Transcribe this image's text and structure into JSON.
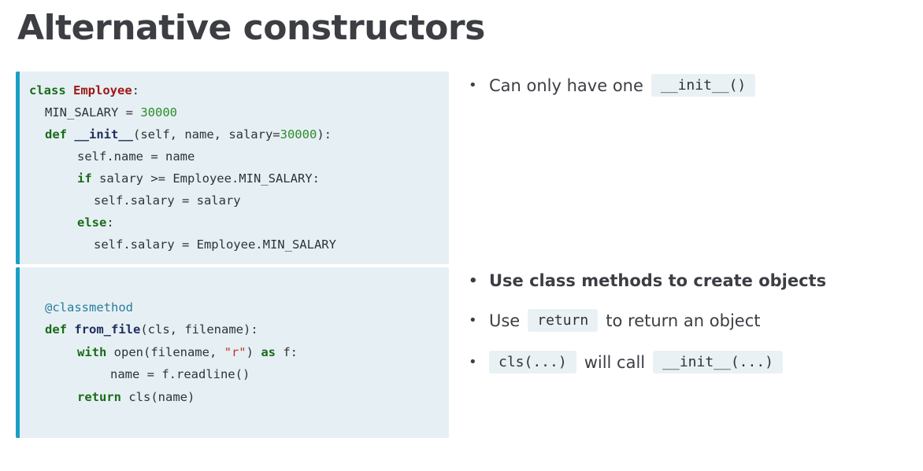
{
  "title": "Alternative constructors",
  "code1": {
    "l1_kw": "class",
    "l1_name": "Employee",
    "l1_colon": ":",
    "l2_text": "MIN_SALARY = ",
    "l2_num": "30000",
    "l3_kw": "def",
    "l3_name": "__init__",
    "l3_args": "(self, name, salary=",
    "l3_num": "30000",
    "l3_end": "):",
    "l4": "self.name = name",
    "l5_kw": "if",
    "l5_text": " salary >= Employee.MIN_SALARY:",
    "l6": "self.salary = salary",
    "l7_kw": "else",
    "l7_colon": ":",
    "l8": "self.salary = Employee.MIN_SALARY"
  },
  "code2": {
    "deco": "@classmethod",
    "def_kw": "def",
    "def_name": "from_file",
    "def_args": "(cls, filename):",
    "with_kw": "with",
    "with_text1": " open(filename, ",
    "with_str": "\"r\"",
    "with_text2": ") ",
    "as_kw": "as",
    "with_text3": " f:",
    "name_line": "name = f.readline()",
    "return_kw": "return",
    "return_text": " cls(name)"
  },
  "bullets": {
    "b1_text": "Can only have one",
    "b1_chip": "__init__()",
    "b2_text": "Use class methods to create objects",
    "b3_pre": "Use",
    "b3_chip": "return",
    "b3_post": "to return an object",
    "b4_chip1": "cls(...)",
    "b4_mid": "will call",
    "b4_chip2": "__init__(...)",
    "bullet_glyph": "•"
  }
}
